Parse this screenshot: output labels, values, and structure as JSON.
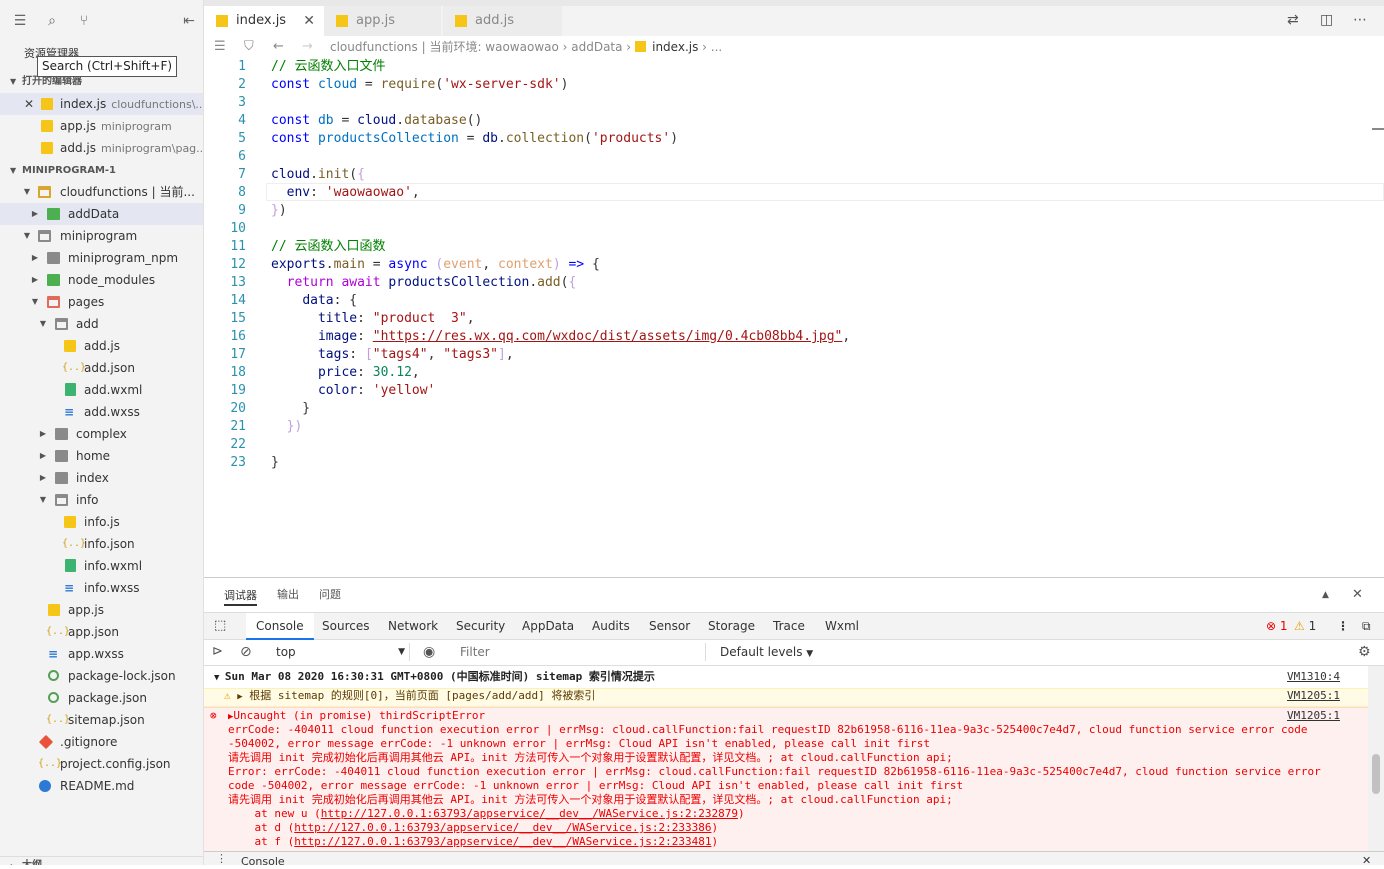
{
  "sidebar": {
    "title": "资源管理器",
    "tooltip": "Search (Ctrl+Shift+F)",
    "open_editors_label": "打开的编辑器",
    "open_editors": [
      {
        "name": "index.js",
        "path": "cloudfunctions\\..."
      },
      {
        "name": "app.js",
        "path": "miniprogram"
      },
      {
        "name": "add.js",
        "path": "miniprogram\\pag..."
      }
    ],
    "project_label": "MINIPROGRAM-1",
    "tree": [
      "cloudfunctions | 当前...",
      "addData",
      "miniprogram",
      "miniprogram_npm",
      "node_modules",
      "pages",
      "add",
      "add.js",
      "add.json",
      "add.wxml",
      "add.wxss",
      "complex",
      "home",
      "index",
      "info",
      "info.js",
      "info.json",
      "info.wxml",
      "info.wxss",
      "app.js",
      "app.json",
      "app.wxss",
      "package-lock.json",
      "package.json",
      "sitemap.json",
      ".gitignore",
      "project.config.json",
      "README.md"
    ],
    "bottom_label": "大纲"
  },
  "tabs": [
    {
      "label": "index.js",
      "active": true
    },
    {
      "label": "app.js",
      "active": false
    },
    {
      "label": "add.js",
      "active": false
    }
  ],
  "breadcrumb": {
    "path": "cloudfunctions | 当前环境: waowaowao › addData ›",
    "file": "index.js",
    "tail": "› ..."
  },
  "code": {
    "line_numbers": [
      "1",
      "2",
      "3",
      "4",
      "5",
      "6",
      "7",
      "8",
      "9",
      "10",
      "11",
      "12",
      "13",
      "14",
      "15",
      "16",
      "17",
      "18",
      "19",
      "20",
      "21",
      "22",
      "23"
    ],
    "c1": "// 云函数入口文件",
    "c11": "// 云函数入口函数",
    "s_sdk": "'wx-server-sdk'",
    "s_products": "'products'",
    "s_env": "'waowaowao'",
    "s_title": "\"product  3\"",
    "s_image": "\"https://res.wx.qq.com/wxdoc/dist/assets/img/0.4cb08bb4.jpg\"",
    "s_tag4": "\"tags4\"",
    "s_tag3": "\"tags3\"",
    "n_price": "30.12",
    "s_color": "'yellow'"
  },
  "devtools": {
    "tabs": [
      "调试器",
      "输出",
      "问题"
    ],
    "panels": [
      "Console",
      "Sources",
      "Network",
      "Security",
      "AppData",
      "Audits",
      "Sensor",
      "Storage",
      "Trace",
      "Wxml"
    ],
    "error_count": "1",
    "warn_count": "1",
    "context": "top",
    "filter_placeholder": "Filter",
    "levels": "Default levels",
    "messages": {
      "info": "Sun Mar 08 2020 16:30:31 GMT+0800 (中国标准时间) sitemap 索引情况提示",
      "info_src": "VM1310:4",
      "warn": "根据 sitemap 的规则[0]，当前页面 [pages/add/add] 将被索引",
      "warn_src": "VM1205:1",
      "err_title": "Uncaught (in promise) thirdScriptError",
      "err_src": "VM1205:1",
      "err_lines": [
        "errCode: -404011 cloud function execution error | errMsg: cloud.callFunction:fail requestID 82b61958-6116-11ea-9a3c-525400c7e4d7, cloud function service error code",
        "-504002, error message errCode: -1 unknown error | errMsg: Cloud API isn't enabled, please call init first",
        "请先调用 init 完成初始化后再调用其他云 API。init 方法可传入一个对象用于设置默认配置，详见文档。; at cloud.callFunction api;",
        "Error: errCode: -404011 cloud function execution error | errMsg: cloud.callFunction:fail requestID 82b61958-6116-11ea-9a3c-525400c7e4d7, cloud function service error",
        "code -504002, error message errCode: -1 unknown error | errMsg: Cloud API isn't enabled, please call init first",
        "请先调用 init 完成初始化后再调用其他云 API。init 方法可传入一个对象用于设置默认配置，详见文档。; at cloud.callFunction api;"
      ],
      "stack": [
        {
          "pre": "    at new u (",
          "link": "http://127.0.0.1:63793/appservice/__dev__/WAService.js:2:232879",
          "post": ")"
        },
        {
          "pre": "    at d (",
          "link": "http://127.0.0.1:63793/appservice/__dev__/WAService.js:2:233386",
          "post": ")"
        },
        {
          "pre": "    at f (",
          "link": "http://127.0.0.1:63793/appservice/__dev__/WAService.js:2:233481",
          "post": ")"
        }
      ]
    },
    "drawer_label": "Console"
  }
}
